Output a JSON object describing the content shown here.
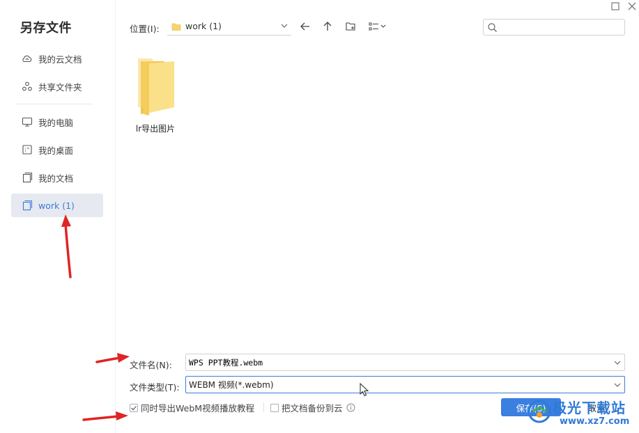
{
  "window": {
    "title": "另存文件"
  },
  "sidebar": {
    "items": [
      {
        "label": "我的云文档",
        "icon": "cloud-icon"
      },
      {
        "label": "共享文件夹",
        "icon": "share-folder-icon"
      },
      {
        "label": "我的电脑",
        "icon": "computer-icon"
      },
      {
        "label": "我的桌面",
        "icon": "desktop-icon"
      },
      {
        "label": "我的文档",
        "icon": "documents-icon"
      },
      {
        "label": "work (1)",
        "icon": "folder-icon",
        "active": true
      }
    ]
  },
  "toolbar": {
    "location_label": "位置(I):",
    "location_value": "work (1)",
    "search_placeholder": ""
  },
  "files": [
    {
      "name": "lr导出图片",
      "type": "folder"
    }
  ],
  "form": {
    "filename_label": "文件名(N):",
    "filename_value": "WPS PPT教程.webm",
    "filetype_label": "文件类型(T):",
    "filetype_value": "WEBM 视频(*.webm)",
    "export_tutorial_label": "同时导出WebM视频播放教程",
    "export_tutorial_checked": true,
    "backup_cloud_label": "把文档备份到云",
    "backup_cloud_checked": false,
    "save_label": "保存(S)",
    "cancel_label": "取消"
  },
  "colors": {
    "accent": "#3b7fe0",
    "active_bg": "#e6e9ef",
    "folder": "#f7d46a",
    "annotation_arrow": "#e02424"
  },
  "watermark": {
    "text": "极光下载站",
    "url": "www.xz7.com"
  }
}
